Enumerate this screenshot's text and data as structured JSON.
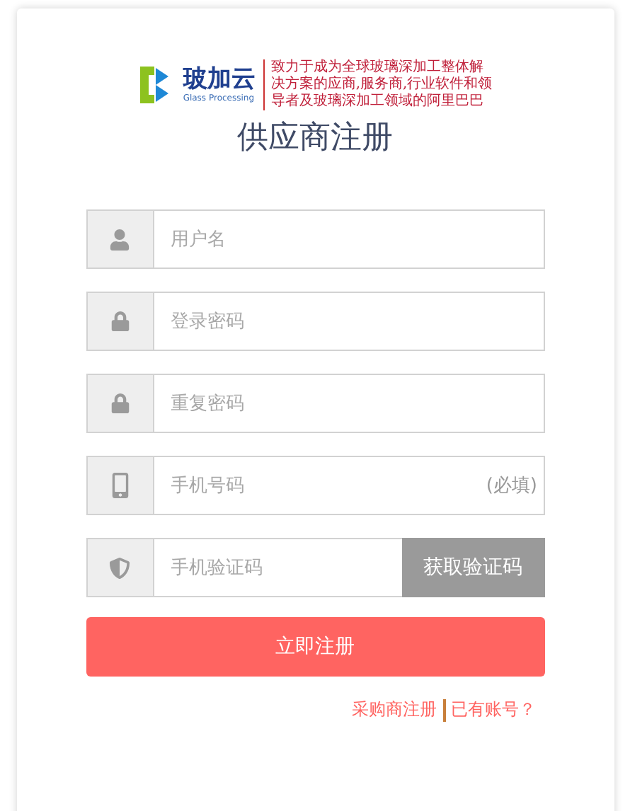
{
  "logo": {
    "name": "玻加云",
    "subtitle": "Glass Processing",
    "slogan": [
      "致力于成为全球玻璃深加工整体解",
      "决方案的应商,服务商,行业软件和领",
      "导者及玻璃深加工领域的阿里巴巴"
    ]
  },
  "title": "供应商注册",
  "fields": [
    {
      "kind": "user",
      "placeholder": "用户名"
    },
    {
      "kind": "lock",
      "placeholder": "登录密码"
    },
    {
      "kind": "lock",
      "placeholder": "重复密码"
    },
    {
      "kind": "phone",
      "placeholder": "手机号码",
      "suffix": "(必填)"
    },
    {
      "kind": "shield",
      "placeholder": "手机验证码",
      "button": "获取验证码"
    }
  ],
  "submit": "立即注册",
  "links": [
    "采购商注册",
    "已有账号？"
  ]
}
